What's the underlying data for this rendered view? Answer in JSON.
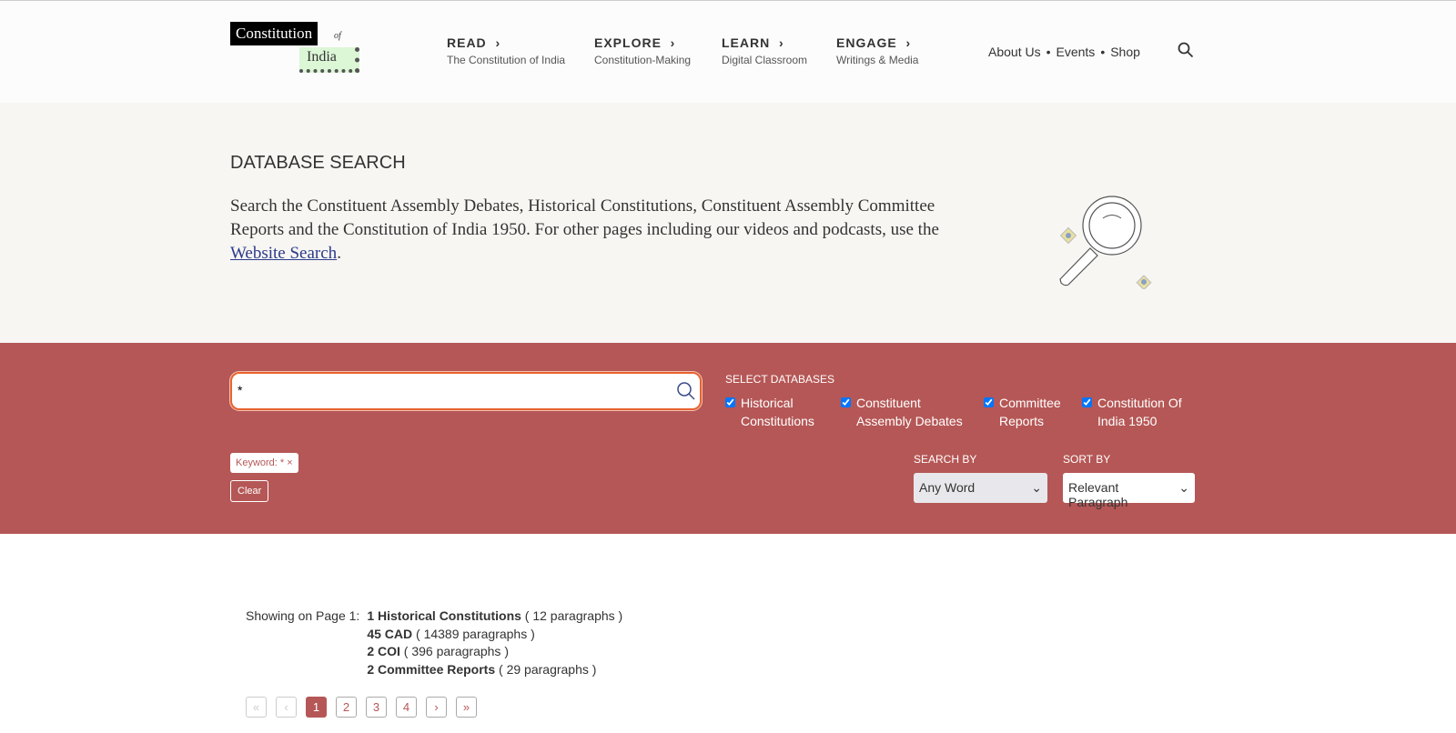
{
  "logo": {
    "line1": "Constitution",
    "of": "of",
    "line2": "India"
  },
  "nav": [
    {
      "title": "READ",
      "sub": "The Constitution of India"
    },
    {
      "title": "EXPLORE",
      "sub": "Constitution-Making"
    },
    {
      "title": "LEARN",
      "sub": "Digital Classroom"
    },
    {
      "title": "ENGAGE",
      "sub": "Writings & Media"
    }
  ],
  "links": [
    "About Us",
    "Events",
    "Shop"
  ],
  "hero": {
    "title": "DATABASE SEARCH",
    "text": "Search the Constituent Assembly Debates, Historical Constitutions, Constituent Assembly Committee Reports and the Constitution of India 1950. For other pages including our videos and podcasts, use the ",
    "link": "Website Search",
    "end": "."
  },
  "search": {
    "value": "*",
    "select_title": "SELECT DATABASES",
    "databases": [
      {
        "label": "Historical Constitutions",
        "checked": true
      },
      {
        "label": "Constituent Assembly Debates",
        "checked": true
      },
      {
        "label": "Committee Reports",
        "checked": true
      },
      {
        "label": "Constitution Of India 1950",
        "checked": true
      }
    ],
    "chip": "Keyword: * ×",
    "clear": "Clear",
    "search_by_label": "SEARCH BY",
    "search_by": "Any Word",
    "sort_by_label": "SORT BY",
    "sort_by": "Relevant Paragraph"
  },
  "results": {
    "label": "Showing on Page 1:",
    "rows": [
      {
        "b": "1 Historical Constitutions",
        "r": " ( 12 paragraphs )"
      },
      {
        "b": "45 CAD",
        "r": " ( 14389 paragraphs )"
      },
      {
        "b": "2 COI",
        "r": " ( 396 paragraphs )"
      },
      {
        "b": "2 Committee Reports",
        "r": " ( 29 paragraphs )"
      }
    ]
  },
  "pagination": {
    "items": [
      "«",
      "‹",
      "1",
      "2",
      "3",
      "4",
      "›",
      "»"
    ],
    "current": "1"
  },
  "colors": {
    "band": "#b55756",
    "accent": "#e8632f"
  }
}
